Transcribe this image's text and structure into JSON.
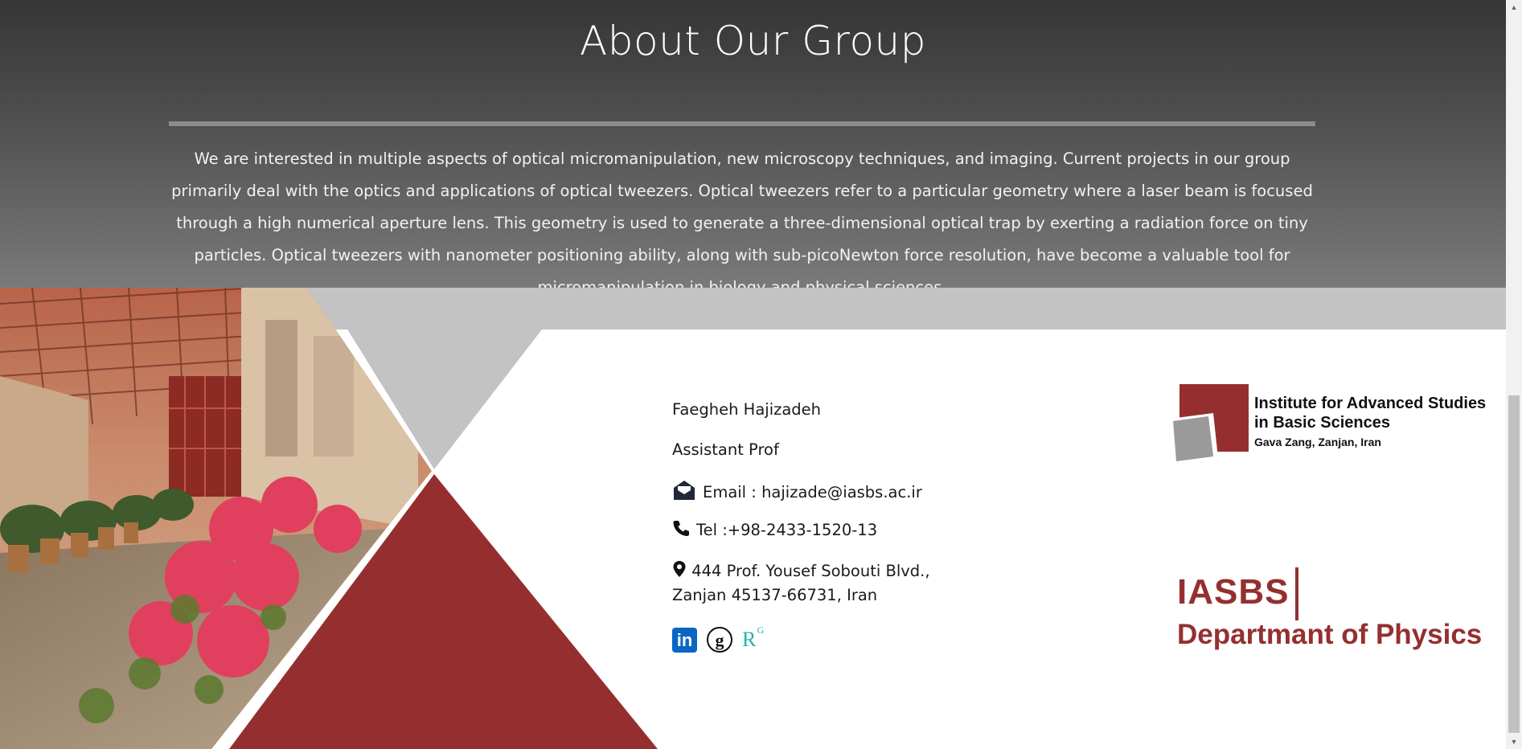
{
  "about": {
    "title": "About Our Group",
    "paragraph": "We are interested in multiple aspects of optical micromanipulation, new microscopy techniques, and imaging. Current projects in our group primarily deal with the optics and applications of optical tweezers. Optical tweezers refer to a particular geometry where a laser beam is focused through a high numerical aperture lens. This geometry is used to generate a three-dimensional optical trap by exerting a radiation force on tiny particles. Optical tweezers with nanometer positioning ability, along with sub-picoNewton force resolution, have become a valuable tool for micromanipulation in biology and physical sciences."
  },
  "contact": {
    "name": "Faegheh Hajizadeh",
    "position": "Assistant Prof",
    "email_label": "Email : hajizade@iasbs.ac.ir",
    "tel_label": "Tel :+98-2433-1520-13",
    "address_line1": "444 Prof. Yousef Sobouti Blvd.,",
    "address_line2": "Zanjan 45137-66731, Iran",
    "social": [
      {
        "name": "linkedin",
        "glyph": "in"
      },
      {
        "name": "google-scholar",
        "glyph": "g"
      },
      {
        "name": "researchgate",
        "glyph": "R",
        "sup": "G"
      }
    ]
  },
  "institute_logo": {
    "line1": "Institute for Advanced Studies",
    "line2": "in Basic Sciences",
    "line3": "Gava Zang, Zanjan, Iran"
  },
  "department_logo": {
    "abbr": "IASBS",
    "department": "Departmant of Physics"
  },
  "colors": {
    "accent": "#952f2f",
    "gray_band": "#c3c3c3",
    "linkedin": "#0a66c2",
    "researchgate": "#1fb5a8"
  }
}
